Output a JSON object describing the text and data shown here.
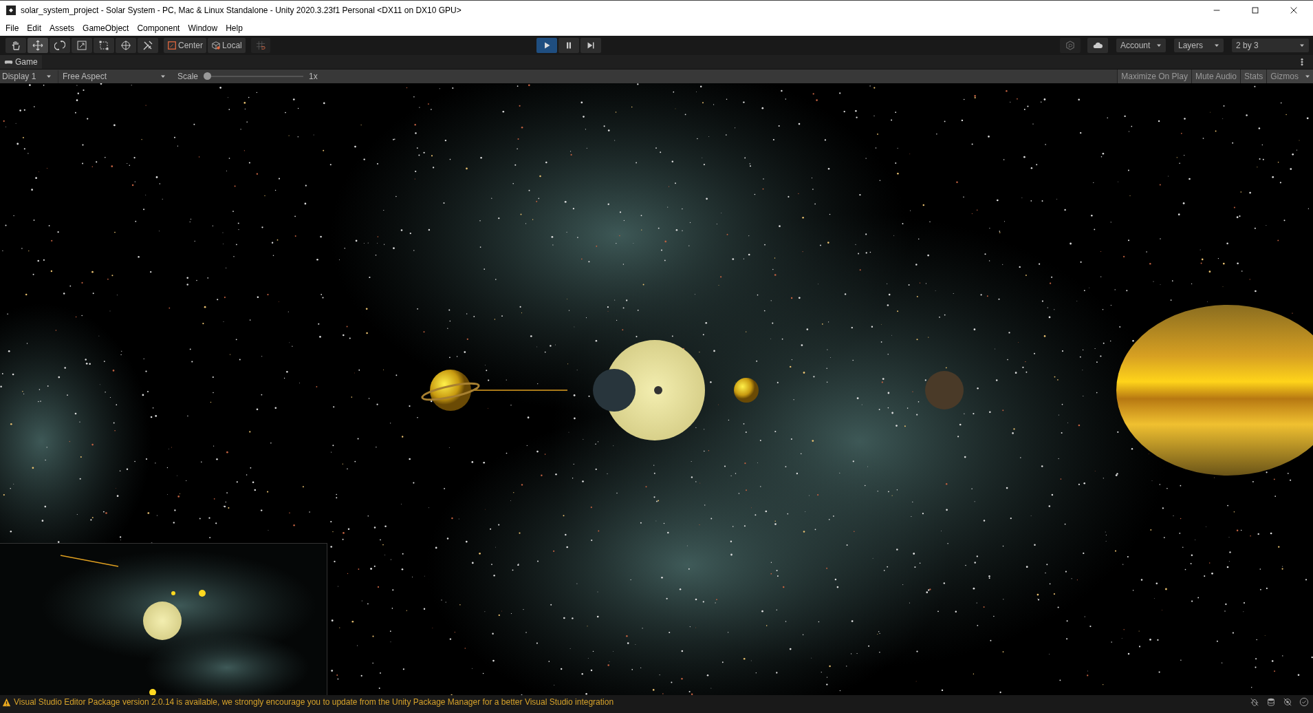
{
  "window": {
    "title": "solar_system_project - Solar System - PC, Mac & Linux Standalone - Unity 2020.3.23f1 Personal <DX11 on DX10 GPU>"
  },
  "menu": [
    "File",
    "Edit",
    "Assets",
    "GameObject",
    "Component",
    "Window",
    "Help"
  ],
  "toolbar": {
    "tools": [
      {
        "kind": "hand",
        "selected": false
      },
      {
        "kind": "move",
        "selected": true
      },
      {
        "kind": "rotate",
        "selected": false
      },
      {
        "kind": "scale",
        "selected": false
      },
      {
        "kind": "rect",
        "selected": false
      },
      {
        "kind": "transform",
        "selected": false
      },
      {
        "kind": "custom",
        "selected": false
      }
    ],
    "pivot_toggles": [
      {
        "kind": "center",
        "label": "Center"
      },
      {
        "kind": "local",
        "label": "Local"
      }
    ],
    "playback": [
      {
        "kind": "play",
        "selected": true
      },
      {
        "kind": "pause",
        "selected": false
      },
      {
        "kind": "step",
        "selected": false
      }
    ],
    "dropdowns": [
      "Account",
      "Layers",
      "2 by 3"
    ]
  },
  "game_panel": {
    "tab": "Game",
    "display": "Display 1",
    "aspect": "Free Aspect",
    "scale_label": "Scale",
    "scale": {
      "level": 0.0
    },
    "scale_reading": "1x",
    "toggles": [
      {
        "label": "Maximize On Play",
        "on": false
      },
      {
        "label": "Mute Audio",
        "on": false
      },
      {
        "label": "Stats",
        "on": false
      },
      {
        "label": "Gizmos",
        "on": false
      }
    ]
  },
  "status_bar": {
    "message": "Visual Studio Editor Package version 2.0.14 is available, we strongly encourage you to update from the Unity Package Manager for a better Visual Studio integration"
  }
}
